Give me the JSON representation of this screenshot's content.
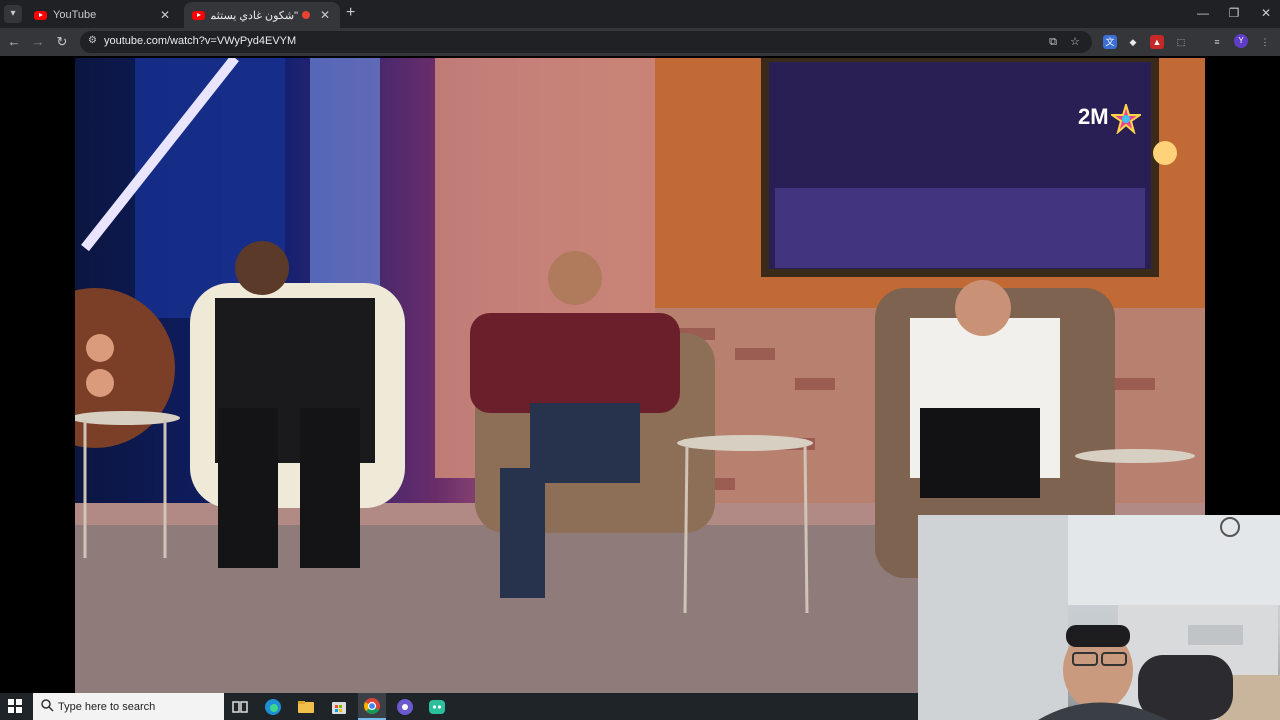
{
  "browser": {
    "tabs": [
      {
        "title": "YouTube",
        "active": false
      },
      {
        "title": "\"شكون غادي يستثمر فمشرو..",
        "active": true,
        "recording": true
      }
    ],
    "url": "youtube.com/watch?v=VWyPyd4EVYM",
    "profile_initial": "Y"
  },
  "video": {
    "channel_logo": "2M"
  },
  "taskbar": {
    "search_placeholder": "Type here to search"
  },
  "colors": {
    "tabstrip": "#202124",
    "toolbar": "#35363a",
    "youtube_red": "#ff0000",
    "taskbar": "#1f2428"
  }
}
